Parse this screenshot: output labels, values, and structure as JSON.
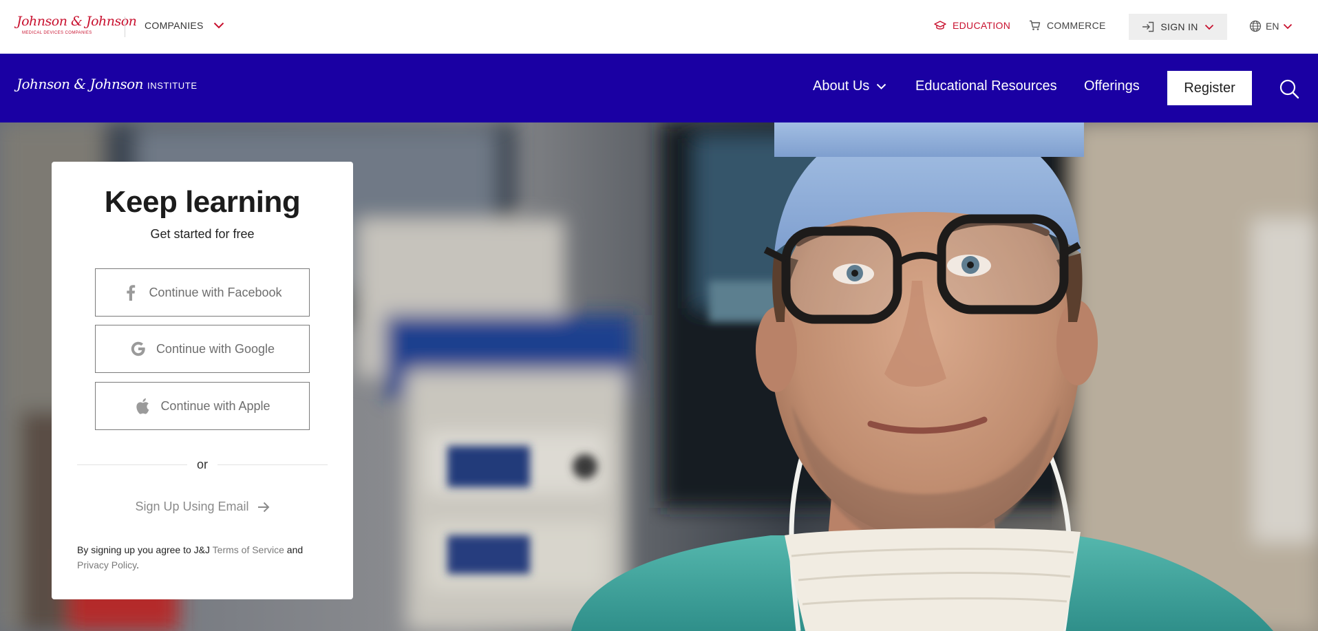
{
  "utility": {
    "logo_script": "Johnson & Johnson",
    "logo_sub": "MEDICAL DEVICES COMPANIES",
    "companies_label": "COMPANIES",
    "education_label": "EDUCATION",
    "commerce_label": "COMMERCE",
    "signin_label": "SIGN IN",
    "language_label": "EN"
  },
  "nav": {
    "logo_script": "Johnson & Johnson",
    "logo_institute": "INSTITUTE",
    "items": [
      {
        "label": "About Us"
      },
      {
        "label": "Educational Resources"
      },
      {
        "label": "Offerings"
      }
    ],
    "register_label": "Register",
    "search_icon": "search-icon"
  },
  "card": {
    "title": "Keep learning",
    "subtitle": "Get started for free",
    "facebook_label": "Continue with Facebook",
    "google_label": "Continue with Google",
    "apple_label": "Continue with Apple",
    "or_label": "or",
    "email_label": "Sign Up Using Email",
    "terms_prefix": "By signing up you agree to J&J",
    "terms_link": "Terms of Service",
    "terms_and": "and",
    "privacy_link": "Privacy Policy",
    "terms_suffix": "."
  },
  "colors": {
    "brand_red": "#c8102e",
    "nav_blue": "#1a00a3"
  }
}
